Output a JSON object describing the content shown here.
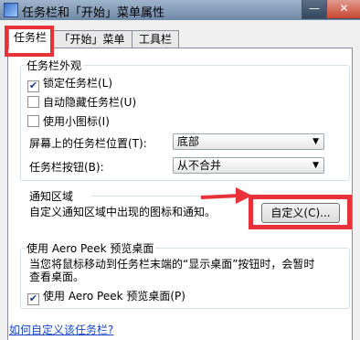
{
  "window": {
    "title": "任务栏和「开始」菜单属性",
    "minimize_icon": "minimize-icon",
    "close_icon": "close-icon"
  },
  "tabs": [
    {
      "label": "任务栏",
      "active": true
    },
    {
      "label": "「开始」菜单",
      "active": false
    },
    {
      "label": "工具栏",
      "active": false
    }
  ],
  "appearance": {
    "legend": "任务栏外观",
    "lock_taskbar": {
      "label": "锁定任务栏(L)",
      "checked": true
    },
    "auto_hide": {
      "label": "自动隐藏任务栏(U)",
      "checked": false
    },
    "small_icons": {
      "label": "使用小图标(I)",
      "checked": false
    },
    "location_label": "屏幕上的任务栏位置(T):",
    "location_value": "底部",
    "buttons_label": "任务栏按钮(B):",
    "buttons_value": "从不合并"
  },
  "notification": {
    "legend": "通知区域",
    "description": "自定义通知区域中出现的图标和通知。",
    "customize_button": "自定义(C)..."
  },
  "aero_peek": {
    "legend": "使用 Aero Peek 预览桌面",
    "description_line1": "当您将鼠标移动到任务栏末端的“显示桌面”按钮时，会暂时",
    "description_line2": "查看桌面。",
    "checkbox": {
      "label": "使用 Aero Peek 预览桌面(P)",
      "checked": true
    }
  },
  "footer": {
    "help_link": "如何自定义该任务栏?"
  },
  "colors": {
    "annotation_red": "#e8323a",
    "link_blue": "#1a47c8"
  }
}
